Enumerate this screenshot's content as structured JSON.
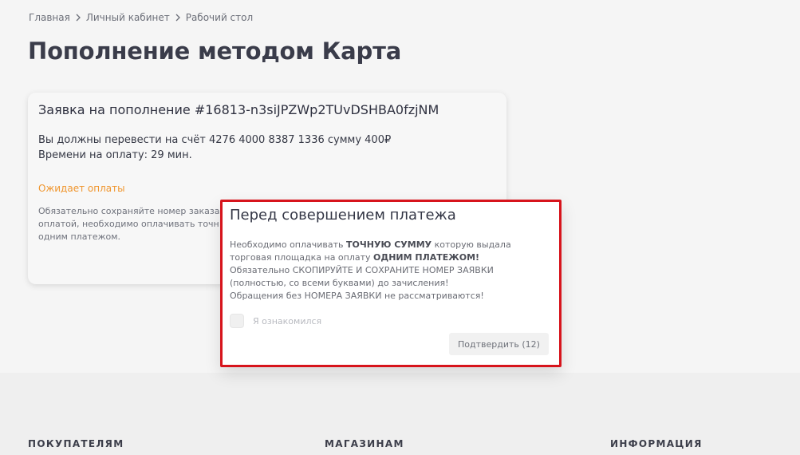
{
  "breadcrumb": [
    "Главная",
    "Личный кабинет",
    "Рабочий стол"
  ],
  "page": {
    "title": "Пополнение методом Карта"
  },
  "request": {
    "title": "Заявка на пополнение #16813-n3siJPZWp2TUvDSHBA0fzjNM",
    "transfer_line": "Вы должны перевести на счёт 4276 4000 8387 1336 сумму 400₽",
    "time_line": "Времени на оплату: 29 мин.",
    "status": "Ожидает оплаты",
    "note": {
      "line1": "Обязательно сохраняйте номер заказа",
      "line2": "оплатой, необходимо оплачивать точн",
      "line3": "одним платежом."
    }
  },
  "modal": {
    "title": "Перед совершением платежа",
    "body": {
      "p1_before": "Необходимо оплачивать ",
      "p1_bold": "ТОЧНУЮ СУММУ",
      "p1_after": " которую выдала",
      "p2_before": "торговая площадка на оплату ",
      "p2_bold": "ОДНИМ ПЛАТЕЖОМ!",
      "line3": "Обязательно СКОПИРУЙТЕ И СОХРАНИТЕ НОМЕР ЗАЯВКИ",
      "line4": "(полностью, со всеми буквами) до зачисления!",
      "line5": "Обращения без НОМЕРА ЗАЯВКИ не рассматриваются!"
    },
    "agree_label": "Я ознакомился",
    "confirm_label": "Подтвердить (12)"
  },
  "footer": {
    "col1": "ПОКУПАТЕЛЯМ",
    "col2": "МАГАЗИНАМ",
    "col3": "ИНФОРМАЦИЯ"
  },
  "colors": {
    "status": "#f0962e",
    "highlight_border": "#d7141c"
  }
}
